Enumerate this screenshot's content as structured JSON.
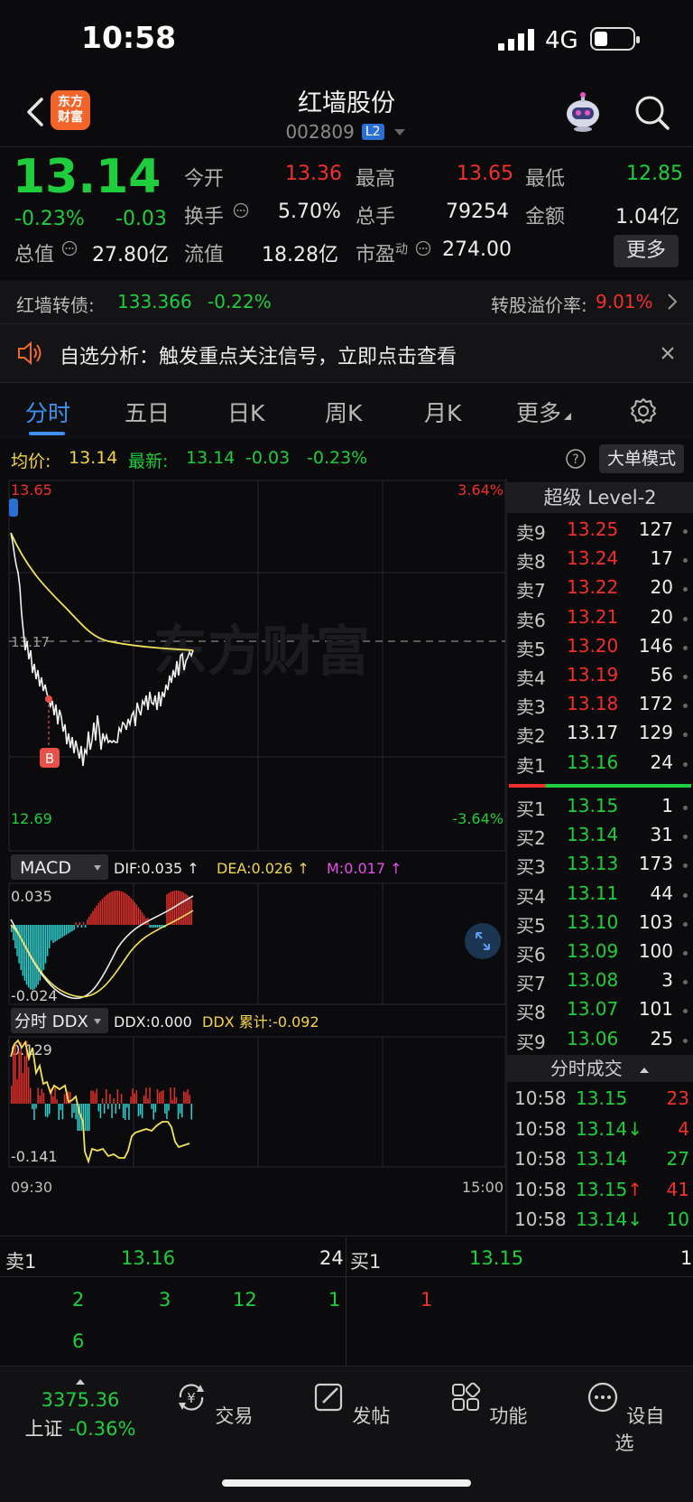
{
  "status_bar": {
    "time": "10:58",
    "network": "4G"
  },
  "header": {
    "logo_line1": "东方",
    "logo_line2": "财富",
    "name": "红墙股份",
    "code": "002809",
    "level_badge": "L2"
  },
  "quote": {
    "price": "13.14",
    "change_pct": "-0.23%",
    "change": "-0.03",
    "open_label": "今开",
    "open": "13.36",
    "high_label": "最高",
    "high": "13.65",
    "low_label": "最低",
    "low": "12.85",
    "turnover_label": "换手",
    "turnover": "5.70%",
    "volume_label": "总手",
    "volume": "79254",
    "amount_label": "金额",
    "amount": "1.04亿",
    "total_mv_label": "总值",
    "total_mv": "27.80亿",
    "float_mv_label": "流值",
    "float_mv": "18.28亿",
    "pe_label": "市盈",
    "pe_sup": "动",
    "pe": "274.00",
    "more": "更多"
  },
  "bond": {
    "name": "红墙转债:",
    "price": "133.366",
    "change_pct": "-0.22%",
    "premium_label": "转股溢价率:",
    "premium": "9.01%"
  },
  "notice": {
    "text": "自选分析：触发重点关注信号，立即点击查看"
  },
  "tabs": [
    "分时",
    "五日",
    "日K",
    "周K",
    "月K",
    "更多"
  ],
  "chart_info": {
    "avg_label": "均价:",
    "avg": "13.14",
    "latest_label": "最新:",
    "latest": "13.14",
    "change": "-0.03",
    "change_pct": "-0.23%",
    "big_order_mode": "大单模式"
  },
  "intraday": {
    "price_max": "13.65",
    "price_min": "12.69",
    "pct_max": "3.64%",
    "pct_min": "-3.64%",
    "prev_close": "13.17",
    "watermark": "东方财富",
    "buy_marker": "B",
    "time_start": "09:30",
    "time_end": "15:00"
  },
  "macd": {
    "selector": "MACD",
    "dif": "DIF:0.035 ↑",
    "dea": "DEA:0.026 ↑",
    "m": "M:0.017 ↑",
    "max": "0.035",
    "min": "-0.024"
  },
  "ddx": {
    "selector": "分时 DDX",
    "ddx": "DDX:0.000",
    "cum": "DDX 累计:-0.092",
    "max": "0.129",
    "min": "-0.141"
  },
  "order_book": {
    "title": "超级 Level-2",
    "asks": [
      {
        "label": "卖9",
        "price": "13.25",
        "vol": "127",
        "color": "red"
      },
      {
        "label": "卖8",
        "price": "13.24",
        "vol": "17",
        "color": "red"
      },
      {
        "label": "卖7",
        "price": "13.22",
        "vol": "20",
        "color": "red"
      },
      {
        "label": "卖6",
        "price": "13.21",
        "vol": "20",
        "color": "red"
      },
      {
        "label": "卖5",
        "price": "13.20",
        "vol": "146",
        "color": "red"
      },
      {
        "label": "卖4",
        "price": "13.19",
        "vol": "56",
        "color": "red"
      },
      {
        "label": "卖3",
        "price": "13.18",
        "vol": "172",
        "color": "red"
      },
      {
        "label": "卖2",
        "price": "13.17",
        "vol": "129",
        "color": "white"
      },
      {
        "label": "卖1",
        "price": "13.16",
        "vol": "24",
        "color": "green"
      }
    ],
    "bids": [
      {
        "label": "买1",
        "price": "13.15",
        "vol": "1",
        "color": "green"
      },
      {
        "label": "买2",
        "price": "13.14",
        "vol": "31",
        "color": "green"
      },
      {
        "label": "买3",
        "price": "13.13",
        "vol": "173",
        "color": "green"
      },
      {
        "label": "买4",
        "price": "13.11",
        "vol": "44",
        "color": "green"
      },
      {
        "label": "买5",
        "price": "13.10",
        "vol": "103",
        "color": "green"
      },
      {
        "label": "买6",
        "price": "13.09",
        "vol": "100",
        "color": "green"
      },
      {
        "label": "买7",
        "price": "13.08",
        "vol": "3",
        "color": "green"
      },
      {
        "label": "买8",
        "price": "13.07",
        "vol": "101",
        "color": "green"
      },
      {
        "label": "买9",
        "price": "13.06",
        "vol": "25",
        "color": "green"
      }
    ]
  },
  "ticks": {
    "title": "分时成交",
    "rows": [
      {
        "time": "10:58",
        "price": "13.15",
        "vol": "23",
        "vol_color": "red"
      },
      {
        "time": "10:58",
        "price": "13.14↓",
        "vol": "4",
        "vol_color": "red"
      },
      {
        "time": "10:58",
        "price": "13.14",
        "vol": "27",
        "vol_color": "green"
      },
      {
        "time": "10:58",
        "price": "13.15↑",
        "vol": "41",
        "vol_color": "red"
      },
      {
        "time": "10:58",
        "price": "13.14↓",
        "vol": "10",
        "vol_color": "green"
      }
    ]
  },
  "bottom_book": {
    "sell_label": "卖1",
    "sell_price": "13.16",
    "sell_vol": "24",
    "buy_label": "买1",
    "buy_price": "13.15",
    "buy_vol": "1",
    "sell_queue": [
      "2",
      "3",
      "12",
      "1",
      "6"
    ],
    "buy_queue": [
      "1"
    ]
  },
  "navbar": {
    "index_value": "3375.36",
    "index_name": "上证",
    "index_change": "-0.36%",
    "items": [
      "交易",
      "发帖",
      "功能",
      "设自选"
    ]
  },
  "colors": {
    "up": "#f0302c",
    "down": "#1fce3c",
    "accent": "#3d8ff0",
    "avg_line": "#f3e25b"
  }
}
